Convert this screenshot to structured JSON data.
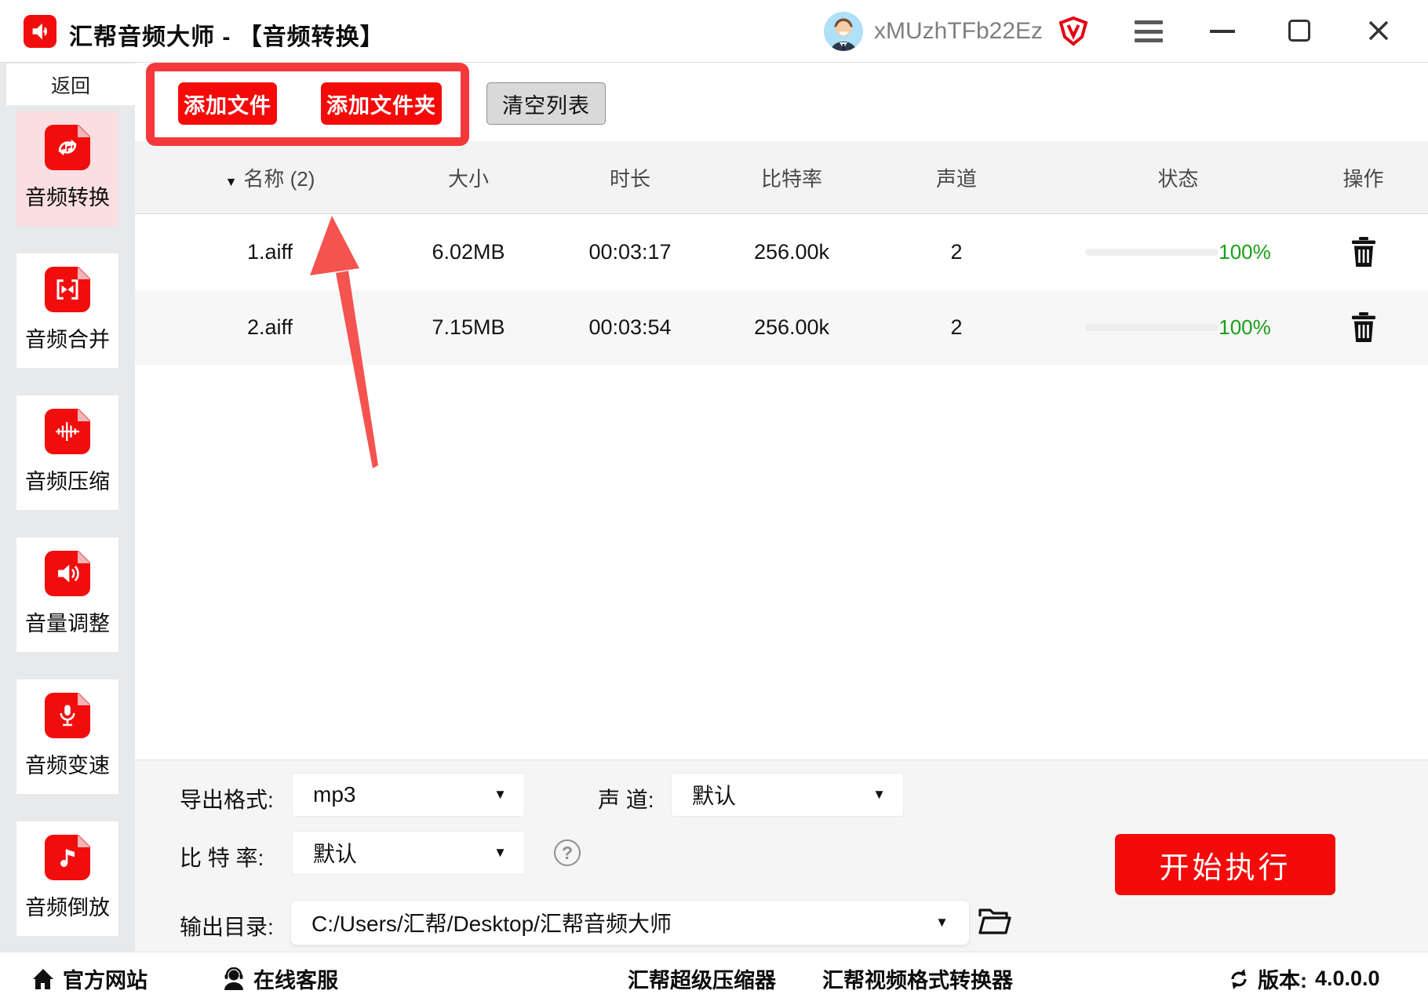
{
  "titlebar": {
    "title": "汇帮音频大师 - 【音频转换】",
    "username": "xMUzhTFb22Ez"
  },
  "sidebar": {
    "back_label": "返回",
    "items": [
      {
        "label": "音频转换",
        "icon": "audio-convert-icon",
        "active": true
      },
      {
        "label": "音频合并",
        "icon": "audio-merge-icon",
        "active": false
      },
      {
        "label": "音频压缩",
        "icon": "audio-compress-icon",
        "active": false
      },
      {
        "label": "音量调整",
        "icon": "volume-adjust-icon",
        "active": false
      },
      {
        "label": "音频变速",
        "icon": "audio-speed-icon",
        "active": false
      },
      {
        "label": "音频倒放",
        "icon": "audio-reverse-icon",
        "active": false
      }
    ]
  },
  "toolbar": {
    "add_file_label": "添加文件",
    "add_folder_label": "添加文件夹",
    "clear_list_label": "清空列表"
  },
  "table": {
    "sort_caret": "▼",
    "columns": [
      "名称 (2)",
      "大小",
      "时长",
      "比特率",
      "声道",
      "状态",
      "操作"
    ],
    "rows": [
      {
        "name": "1.aiff",
        "size": "6.02MB",
        "duration": "00:03:17",
        "bitrate": "256.00k",
        "channels": "2",
        "progress_percent": 100,
        "progress_label": "100%"
      },
      {
        "name": "2.aiff",
        "size": "7.15MB",
        "duration": "00:03:54",
        "bitrate": "256.00k",
        "channels": "2",
        "progress_percent": 100,
        "progress_label": "100%"
      }
    ]
  },
  "settings": {
    "export_format_label": "导出格式:",
    "export_format_value": "mp3",
    "channel_label": "声 道:",
    "channel_value": "默认",
    "bitrate_label": "比 特 率:",
    "bitrate_value": "默认",
    "help_glyph": "?",
    "output_label": "输出目录:",
    "output_value": "C:/Users/汇帮/Desktop/汇帮音频大师",
    "caret": "▼",
    "start_button_label": "开始执行"
  },
  "statusbar": {
    "official_site": "官方网站",
    "online_support": "在线客服",
    "link_compressor": "汇帮超级压缩器",
    "link_video_converter": "汇帮视频格式转换器",
    "version_label": "版本:",
    "version_value": "4.0.0.0"
  },
  "colors": {
    "accent_red": "#f50a0a",
    "annotation_red": "#f5383c",
    "progress_bar_pink": "#e1195f",
    "progress_text_green": "#18a018",
    "active_item_bg": "#fadee2"
  }
}
